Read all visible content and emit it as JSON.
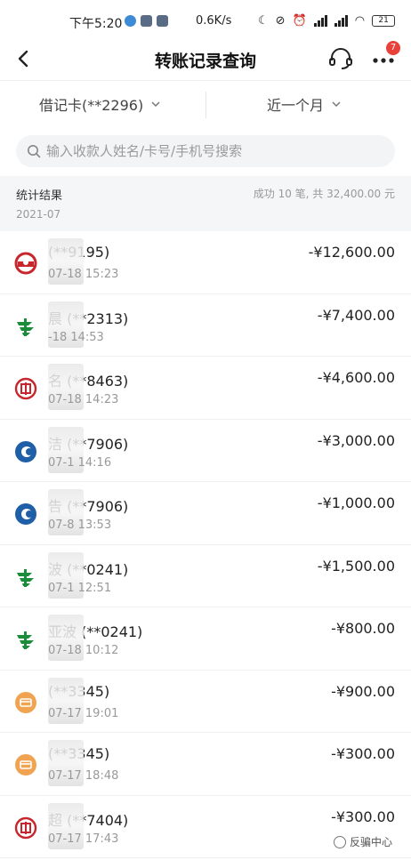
{
  "status_bar": {
    "time": "下午5:20",
    "net_speed": "0.6K/s",
    "battery": "21"
  },
  "header": {
    "title": "转账记录查询",
    "badge_count": "7"
  },
  "filters": {
    "card_label": "借记卡(**2296)",
    "range_label": "近一个月"
  },
  "search": {
    "placeholder": "输入收款人姓名/卡号/手机号搜索"
  },
  "summary": {
    "label": "统计结果",
    "month": "2021-07",
    "stats": "成功 10 笔, 共 32,400.00 元"
  },
  "colors": {
    "red_bank": "#c8262d",
    "green_post": "#1a8c3a",
    "blue_ccb": "#1f5fa8",
    "orange_card": "#f0a452"
  },
  "transactions": [
    {
      "name": "(**9195)",
      "time": "07-18 15:23",
      "amount": "-¥12,600.00",
      "bank_icon": "bank-logo-red-icon"
    },
    {
      "name": "晨 (**2313)",
      "time": "-18 14:53",
      "amount": "-¥7,400.00",
      "bank_icon": "postal-savings-icon"
    },
    {
      "name": "名 (**8463)",
      "time": "07-18 14:23",
      "amount": "-¥4,600.00",
      "bank_icon": "icbc-icon"
    },
    {
      "name": "洁 (**7906)",
      "time": "07-1 14:16",
      "amount": "-¥3,000.00",
      "bank_icon": "ccb-icon"
    },
    {
      "name": "告 (**7906)",
      "time": "07-8 13:53",
      "amount": "-¥1,000.00",
      "bank_icon": "ccb-icon"
    },
    {
      "name": "波 (**0241)",
      "time": "07-1 12:51",
      "amount": "-¥1,500.00",
      "bank_icon": "postal-savings-icon"
    },
    {
      "name": "亚波 (**0241)",
      "time": "07-18 10:12",
      "amount": "-¥800.00",
      "bank_icon": "postal-savings-icon"
    },
    {
      "name": "(**3345)",
      "time": "07-17 19:01",
      "amount": "-¥900.00",
      "bank_icon": "card-icon"
    },
    {
      "name": "(**3345)",
      "time": "07-17 18:48",
      "amount": "-¥300.00",
      "bank_icon": "card-icon"
    },
    {
      "name": "超 (**7404)",
      "time": "07-17 17:43",
      "amount": "-¥300.00",
      "bank_icon": "icbc-icon"
    }
  ],
  "watermark": "反骗中心"
}
